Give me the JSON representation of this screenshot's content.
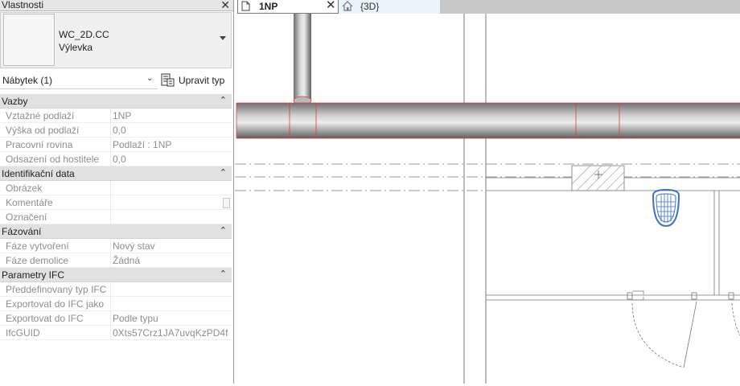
{
  "properties_panel": {
    "title": "Vlastnosti",
    "type_family": "WC_2D.CC",
    "type_name": "Výlevka",
    "filter_label": "Nábytek (1)",
    "edit_type_label": "Upravit typ",
    "groups": [
      {
        "label": "Vazby",
        "rows": [
          {
            "key": "Vztažné podlaží",
            "value": "1NP"
          },
          {
            "key": "Výška od podlaží",
            "value": "0,0"
          },
          {
            "key": "Pracovní rovina",
            "value": "Podlaží : 1NP"
          },
          {
            "key": "Odsazení od hostitele",
            "value": "0,0"
          }
        ]
      },
      {
        "label": "Identifikační data",
        "rows": [
          {
            "key": "Obrázek",
            "value": ""
          },
          {
            "key": "Komentáře",
            "value": ""
          },
          {
            "key": "Označení",
            "value": ""
          }
        ]
      },
      {
        "label": "Fázování",
        "rows": [
          {
            "key": "Fáze vytvoření",
            "value": "Nový stav"
          },
          {
            "key": "Fáze demolice",
            "value": "Žádná"
          }
        ]
      },
      {
        "label": "Parametry IFC",
        "rows": [
          {
            "key": "Předdefinovaný typ IFC",
            "value": ""
          },
          {
            "key": "Exportovat do IFC jako",
            "value": ""
          },
          {
            "key": "Exportovat do IFC",
            "value": "Podle typu"
          },
          {
            "key": "IfcGUID",
            "value": "0Xts57Crz1JA7uvqKzPD4f"
          }
        ]
      }
    ]
  },
  "tabs": [
    {
      "label": "1NP",
      "active": true,
      "icon": "floor-plan-icon"
    },
    {
      "label": "{3D}",
      "active": false,
      "icon": "house-3d-icon"
    }
  ],
  "colors": {
    "pipe_highlight": "#e03c3c",
    "selected_fixture": "#3b6fd4",
    "active_tab_bg": "#ffffff",
    "inactive_tab_bg": "#e9f4fb"
  }
}
